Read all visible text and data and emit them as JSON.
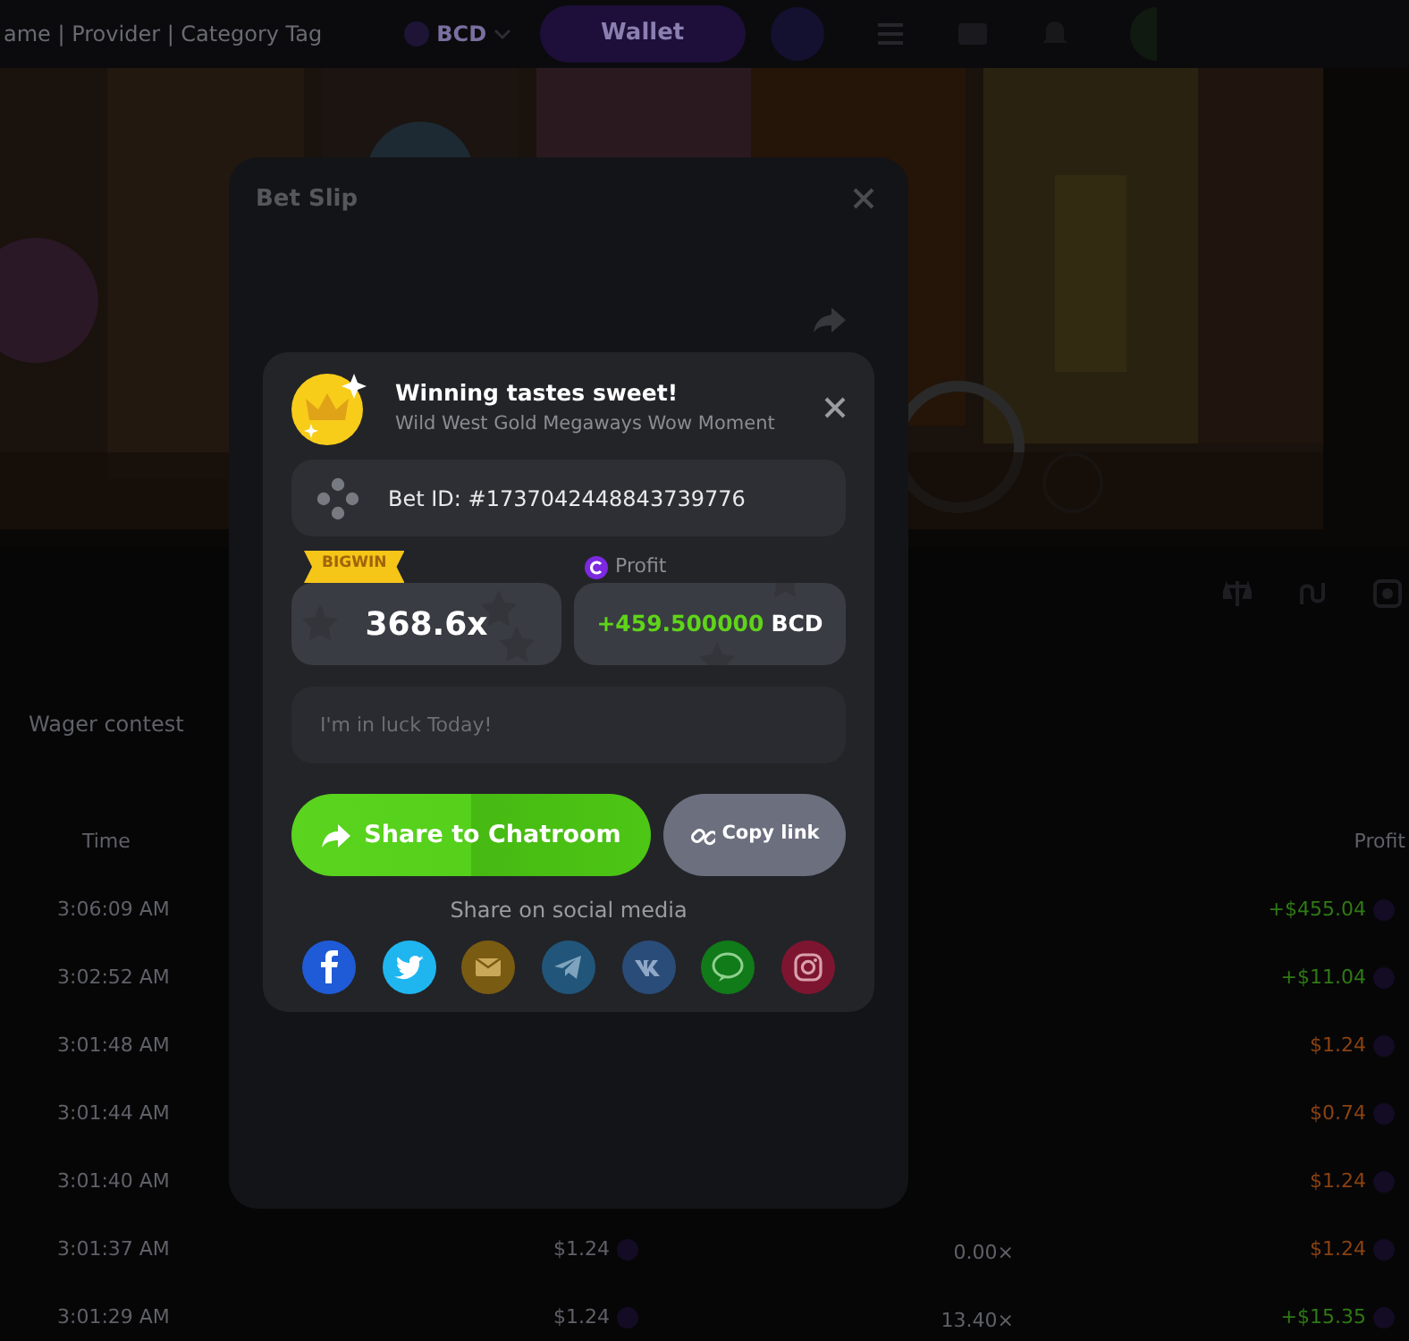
{
  "header": {
    "breadcrumb": "ame | Provider | Category Tag",
    "currency": "BCD",
    "wallet_button": "Wallet"
  },
  "wager_tab": "Wager contest",
  "bets_table": {
    "columns": [
      {
        "label": "Time"
      },
      {
        "label": "Profit"
      }
    ],
    "rows": [
      {
        "time": "3:06:09 AM",
        "profit": "+$455.04",
        "color": "#2f7a14"
      },
      {
        "time": "3:02:52 AM",
        "profit": "+$11.04",
        "color": "#2f7a14"
      },
      {
        "time": "3:01:48 AM",
        "profit": "$1.24",
        "color": "#8a4210"
      },
      {
        "time": "3:01:44 AM",
        "profit": "$0.74",
        "color": "#8a4210"
      },
      {
        "time": "3:01:40 AM",
        "profit": "$1.24",
        "color": "#8a4210"
      },
      {
        "time": "3:01:37 AM",
        "bet": "$1.24",
        "payout": "0.00×",
        "profit": "$1.24",
        "color": "#8a4210"
      },
      {
        "time": "3:01:29 AM",
        "bet": "$1.24",
        "payout": "13.40×",
        "profit": "+$15.35",
        "color": "#2f7a14"
      }
    ]
  },
  "bet_slip": {
    "title": "Bet Slip"
  },
  "win_card": {
    "title": "Winning tastes sweet!",
    "subtitle": "Wild West Gold Megaways Wow Moment",
    "bet_id": "Bet ID: #1737042448843739776",
    "badge": "BIGWIN",
    "multiplier": "368.6x",
    "profit_label": "Profit",
    "profit_amount": "+459.500000",
    "profit_currency": "BCD",
    "message_placeholder": "I'm in luck Today!",
    "share_button": "Share to Chatroom",
    "copy_button": "Copy link",
    "social_heading": "Share on social media",
    "social": [
      {
        "kind": "facebook",
        "color": "#1f5bd6"
      },
      {
        "kind": "twitter",
        "color": "#1fb6f0"
      },
      {
        "kind": "email",
        "color": "#7a5b12"
      },
      {
        "kind": "telegram",
        "color": "#21567a"
      },
      {
        "kind": "vk",
        "color": "#2a4c78"
      },
      {
        "kind": "line",
        "color": "#117a19"
      },
      {
        "kind": "instagram",
        "color": "#7e1530"
      }
    ]
  }
}
